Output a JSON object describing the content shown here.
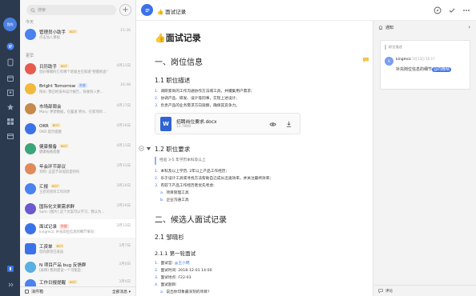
{
  "colors": {
    "rail": "#2b3a4f",
    "accent": "#3b72e8",
    "selected_bg": "#ffffff"
  },
  "rail": {
    "avatar_text": "我的",
    "icons": [
      "chat-icon",
      "document-icon",
      "calendar-icon",
      "contacts-icon",
      "star-icon",
      "apps-icon",
      "box-icon"
    ]
  },
  "chatlist": {
    "search_placeholder": "搜索",
    "section_today": "今天",
    "section_earlier": "更早",
    "items": [
      {
        "name": "管理员小助手",
        "tag": "BOT",
        "sub": "点击加入课程",
        "time": "15:36"
      },
      {
        "name": "日历助手",
        "tag": "BOT",
        "sub": "您好尊敬的它有哪个班级主任知道\"把握机会\"",
        "time": "4月21日"
      },
      {
        "name": "Bright Tomorrow",
        "tag": "外部",
        "sub": "阳光: 我已经发布设计报告，快收快入更…",
        "time": "16:48"
      },
      {
        "name": "市场部周会",
        "tag": "",
        "sub": "Mary: 更新数据，在露道 原价、在新项目…",
        "time": "4月17日"
      },
      {
        "name": "OKR",
        "tag": "BOT",
        "sub": "OKR 提示提醒",
        "time": "4月16日"
      },
      {
        "name": "健康报备",
        "tag": "BOT",
        "sub": "健康报备提醒",
        "time": "4月11日"
      },
      {
        "name": "年会环节部议",
        "tag": "",
        "sub": "刘明: 这是节日提前是吧吗",
        "time": "3月31日"
      },
      {
        "name": "汇报",
        "tag": "BOT",
        "sub": "王老的项目工作同步",
        "time": "3月20日"
      },
      {
        "name": "国际化文案需求群",
        "tag": "",
        "sub": "Sam: [图片] 这个文案可以学习，我认为…",
        "time": "3月20日"
      },
      {
        "name": "面试记录",
        "tag": "外部",
        "sub": "kingmcz: 补充岗位信息的细节情况：",
        "time": "3月13日"
      },
      {
        "name": "工资单",
        "tag": "BOT",
        "sub": "您的薪资已发送",
        "time": "3月7日"
      },
      {
        "name": "N 项目产品 bug 反馈群",
        "tag": "",
        "sub": "[表情] 我的建议一个可能是：",
        "time": "3月6日"
      },
      {
        "name": "工作日报提醒",
        "tag": "BOT",
        "sub": "",
        "time": "3月4日"
      }
    ],
    "footer_left": "消件箱",
    "footer_right": "全部消息 ▾"
  },
  "topbar": {
    "title": "👍 面试记录",
    "icons": [
      "compass-icon",
      "check-icon",
      "more-icon"
    ]
  },
  "doc": {
    "title": "👍面试记录",
    "h1_1": "一、岗位信息",
    "h2_1": "1.1 职位描述",
    "desc": [
      "调研索商的工作沟通协作方法域工具，并撮集用户需求;",
      "协调产品、研发、设计等同事，实现上述设计;",
      "负责产品的业务需求方向观察，确保其竞争力。"
    ],
    "file_name": "招聘岗位要求.docx",
    "file_size": "11.70KB",
    "file_icon_letter": "W",
    "h2_2": "1.2 职位要求",
    "quote": "经验 3-5 年学历本科及以上",
    "req": [
      "本科及以上学历, 2年以上产品工作经历;",
      "乐于设计工具或寻找方法帮助自己成长迅速效率，并关注最终效率;",
      "有较下产品工作经历者优先考虑:"
    ],
    "req_sub": [
      "项目管理工具",
      "企业沟通工具"
    ],
    "h1_2": "二、候选人面试记录",
    "h2_3": "2.1 邹晓杉",
    "h3_1": "2.1.1 第一轮面试",
    "interview": [
      {
        "label": "面试官:",
        "value": "@王小明"
      },
      {
        "label": "面试时间:",
        "value": "2018-12-01 14:00"
      },
      {
        "label": "面试地点:",
        "value": "F22-03"
      },
      {
        "label": "面试题目:",
        "value": ""
      }
    ],
    "interview_sub": "说出你印象最深刻的项目?"
  },
  "panel": {
    "title": "通知",
    "quote": "职位描述",
    "author": "kingmcz",
    "time": "3月13日 16:17",
    "text": "补充岗位信息的细节",
    "mention": "@向晚晴",
    "footer": "评论"
  }
}
